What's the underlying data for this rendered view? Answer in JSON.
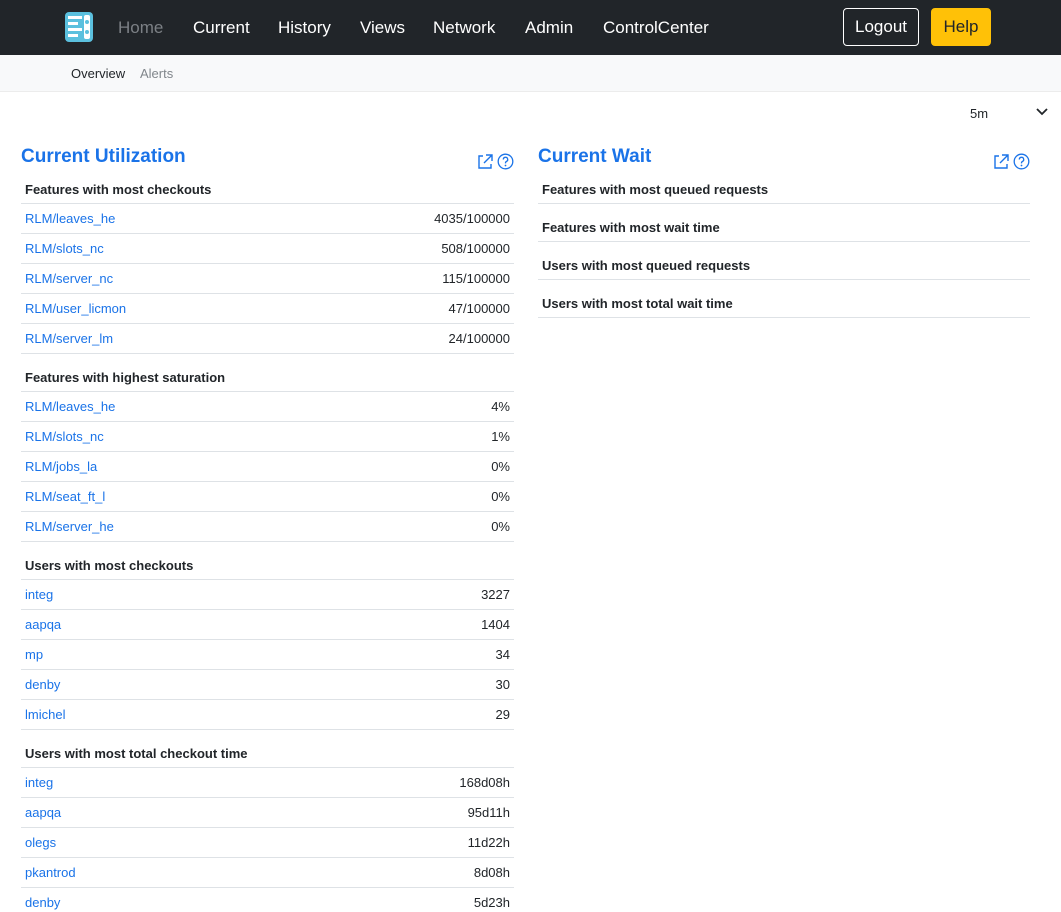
{
  "nav": {
    "items": [
      {
        "label": "Home",
        "active": true
      },
      {
        "label": "Current"
      },
      {
        "label": "History"
      },
      {
        "label": "Views"
      },
      {
        "label": "Network"
      },
      {
        "label": "Admin"
      },
      {
        "label": "ControlCenter"
      }
    ],
    "logout_label": "Logout",
    "help_label": "Help"
  },
  "subnav": {
    "items": [
      {
        "label": "Overview",
        "active": true
      },
      {
        "label": "Alerts"
      }
    ]
  },
  "period": {
    "value": "5m"
  },
  "utilization": {
    "title": "Current Utilization",
    "sections": [
      {
        "header": "Features with most checkouts",
        "rows": [
          {
            "name": "RLM/leaves_he",
            "value": "4035/100000"
          },
          {
            "name": "RLM/slots_nc",
            "value": "508/100000"
          },
          {
            "name": "RLM/server_nc",
            "value": "115/100000"
          },
          {
            "name": "RLM/user_licmon",
            "value": "47/100000"
          },
          {
            "name": "RLM/server_lm",
            "value": "24/100000"
          }
        ]
      },
      {
        "header": "Features with highest saturation",
        "rows": [
          {
            "name": "RLM/leaves_he",
            "value": "4%"
          },
          {
            "name": "RLM/slots_nc",
            "value": "1%"
          },
          {
            "name": "RLM/jobs_la",
            "value": "0%"
          },
          {
            "name": "RLM/seat_ft_l",
            "value": "0%"
          },
          {
            "name": "RLM/server_he",
            "value": "0%"
          }
        ]
      },
      {
        "header": "Users with most checkouts",
        "rows": [
          {
            "name": "integ",
            "value": "3227"
          },
          {
            "name": "aapqa",
            "value": "1404"
          },
          {
            "name": "mp",
            "value": "34"
          },
          {
            "name": "denby",
            "value": "30"
          },
          {
            "name": "lmichel",
            "value": "29"
          }
        ]
      },
      {
        "header": "Users with most total checkout time",
        "rows": [
          {
            "name": "integ",
            "value": "168d08h"
          },
          {
            "name": "aapqa",
            "value": "95d11h"
          },
          {
            "name": "olegs",
            "value": "11d22h"
          },
          {
            "name": "pkantrod",
            "value": "8d08h"
          },
          {
            "name": "denby",
            "value": "5d23h"
          }
        ]
      }
    ]
  },
  "wait": {
    "title": "Current Wait",
    "sections": [
      {
        "header": "Features with most queued requests"
      },
      {
        "header": "Features with most wait time"
      },
      {
        "header": "Users with most queued requests"
      },
      {
        "header": "Users with most total wait time"
      }
    ]
  },
  "colors": {
    "navbar": "#212529",
    "link": "#1a73e8",
    "help_button": "#ffc107",
    "subnav": "#f8f9fa"
  },
  "icons": {
    "logo": "app-logo",
    "external_link": "external-link-icon",
    "help": "question-circle-icon",
    "chevron": "chevron-down-icon"
  }
}
